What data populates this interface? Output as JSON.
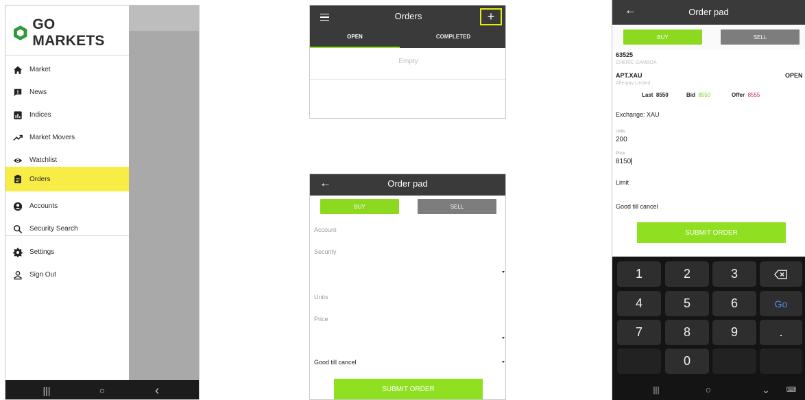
{
  "colors": {
    "brand_green": "#8fe020",
    "header_dark": "#3a3a3a",
    "sell_grey": "#7d7d7d",
    "active_yellow": "#f8ec47",
    "highlight_outline": "#e6ee10",
    "bid_green": "#7dd028",
    "offer_red": "#c0285a",
    "keypad_bg": "#141414"
  },
  "menu": {
    "logo_text": "GO MARKETS",
    "items": [
      {
        "label": "Market",
        "icon": "home-icon"
      },
      {
        "label": "News",
        "icon": "news-icon"
      },
      {
        "label": "Indices",
        "icon": "indices-icon"
      },
      {
        "label": "Market Movers",
        "icon": "trending-icon"
      },
      {
        "label": "Watchlist",
        "icon": "eye-icon"
      },
      {
        "label": "Orders",
        "icon": "clipboard-icon",
        "active": true
      },
      {
        "label": "Accounts",
        "icon": "account-icon"
      },
      {
        "label": "Security Search",
        "icon": "search-icon"
      },
      {
        "label": "Settings",
        "icon": "gear-icon"
      },
      {
        "label": "Sign Out",
        "icon": "person-icon"
      }
    ],
    "nav": {
      "recents": "|||",
      "home": "○",
      "back": "‹"
    }
  },
  "orders": {
    "title": "Orders",
    "add_label": "+",
    "tabs": [
      "OPEN",
      "COMPLETED"
    ],
    "empty_text": "Empty"
  },
  "order_pad_empty": {
    "title": "Order pad",
    "back_label": "←",
    "buy_label": "BUY",
    "sell_label": "SELL",
    "account_label": "Account",
    "security_label": "Security",
    "units_label": "Units",
    "price_label": "Price",
    "duration_value": "Good till cancel",
    "submit_label": "SUBMIT ORDER"
  },
  "order_pad_filled": {
    "title": "Order pad",
    "back_label": "←",
    "buy_label": "BUY",
    "sell_label": "SELL",
    "account_number": "63525",
    "account_name": "CHERIC GAMBOA",
    "security_code": "APT.XAU",
    "security_status": "OPEN",
    "security_name": "Afterpay Limited",
    "last_label": "Last",
    "last_value": "8550",
    "bid_label": "Bid",
    "bid_value": "8550",
    "offer_label": "Offer",
    "offer_value": "8555",
    "exchange_value": "Exchange: XAU",
    "units_label": "Units",
    "units_value": "200",
    "price_label": "Price",
    "price_value": "8150",
    "order_type_value": "Limit",
    "duration_value": "Good till cancel",
    "submit_label": "SUBMIT ORDER"
  },
  "keypad": {
    "keys": [
      "1",
      "2",
      "3",
      "4",
      "5",
      "6",
      "7",
      "8",
      "9",
      "0",
      "."
    ],
    "go_label": "Go",
    "backspace_icon": "backspace-icon",
    "nav": {
      "recents": "|||",
      "home": "○",
      "hide": "⌄",
      "keyboard": "⌨"
    }
  }
}
